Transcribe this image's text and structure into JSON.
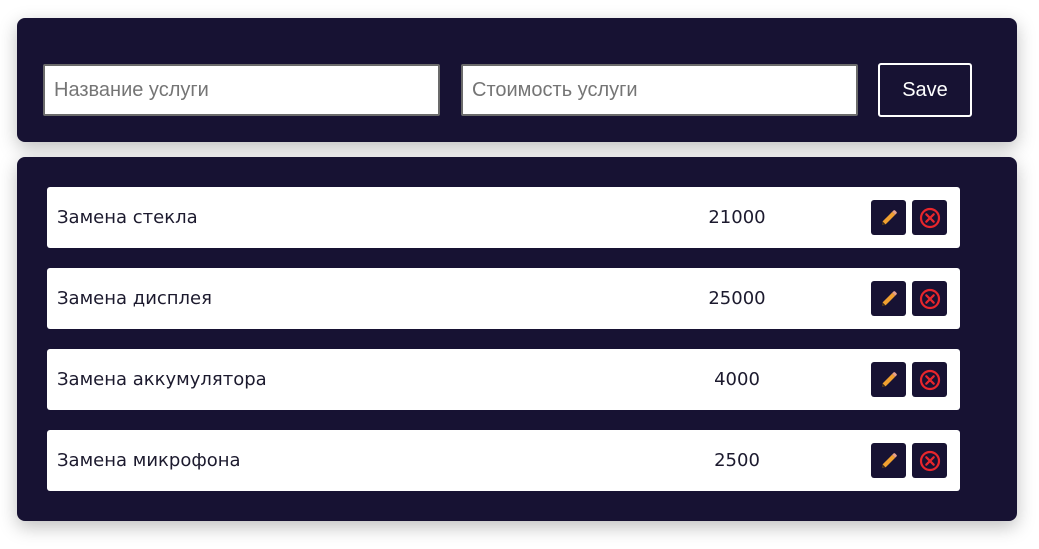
{
  "form": {
    "name_placeholder": "Название услуги",
    "price_placeholder": "Стоимость услуги",
    "save_label": "Save"
  },
  "services": [
    {
      "name": "Замена стекла",
      "price": "21000"
    },
    {
      "name": "Замена дисплея",
      "price": "25000"
    },
    {
      "name": "Замена аккумулятора",
      "price": "4000"
    },
    {
      "name": "Замена микрофона",
      "price": "2500"
    }
  ],
  "icons": {
    "edit": "pencil-icon",
    "delete": "close-circle-icon"
  },
  "colors": {
    "card_background": "#171233",
    "edit_icon": "#f0a030",
    "delete_icon": "#e8262c",
    "save_border": "#ffffff"
  }
}
